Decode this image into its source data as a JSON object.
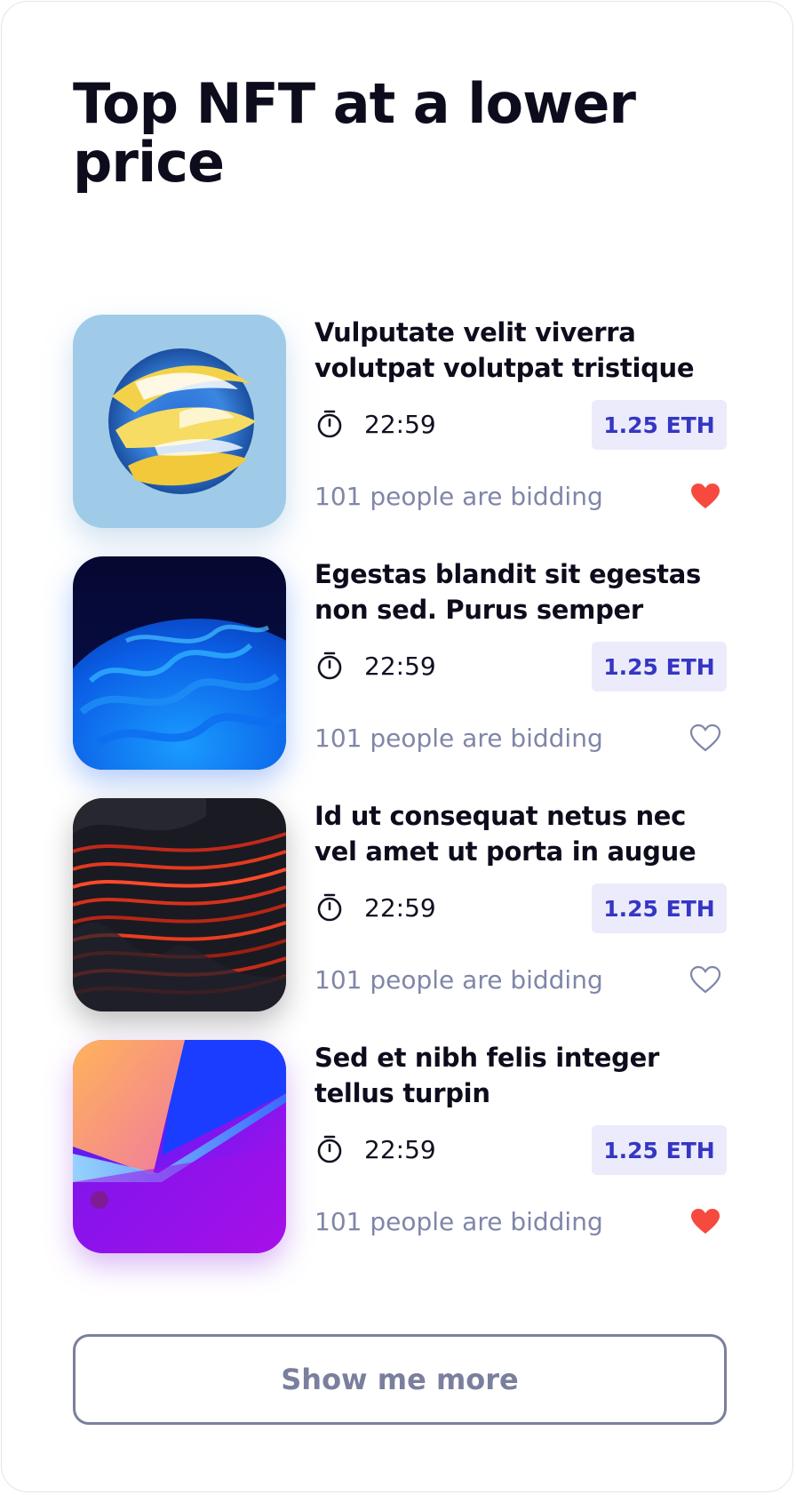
{
  "header": {
    "title": "Top NFT at a lower price"
  },
  "items": [
    {
      "title": "Vulputate velit viverra volutpat volutpat tristique",
      "time": "22:59",
      "price": "1.25 ETH",
      "bidders": "101 people are bidding",
      "liked": true,
      "image": "yellow-blue-paint-sphere"
    },
    {
      "title": "Egestas blandit sit egestas non sed. Purus semper",
      "time": "22:59",
      "price": "1.25 ETH",
      "bidders": "101 people are bidding",
      "liked": false,
      "image": "blue-wavy-sphere"
    },
    {
      "title": "Id ut consequat netus nec vel amet ut porta in augue",
      "time": "22:59",
      "price": "1.25 ETH",
      "bidders": "101 people are bidding",
      "liked": false,
      "image": "red-black-waves"
    },
    {
      "title": "Sed et nibh felis integer tellus turpin",
      "time": "22:59",
      "price": "1.25 ETH",
      "bidders": "101 people are bidding",
      "liked": true,
      "image": "orange-purple-gradient"
    }
  ],
  "footer": {
    "more_label": "Show me more"
  },
  "colors": {
    "heart_liked": "#f54a3d",
    "heart_outline": "#8086a8",
    "price_text": "#3536c4",
    "price_bg": "#ebebfb"
  },
  "icons": {
    "timer": "stopwatch-icon",
    "like": "heart-icon"
  }
}
